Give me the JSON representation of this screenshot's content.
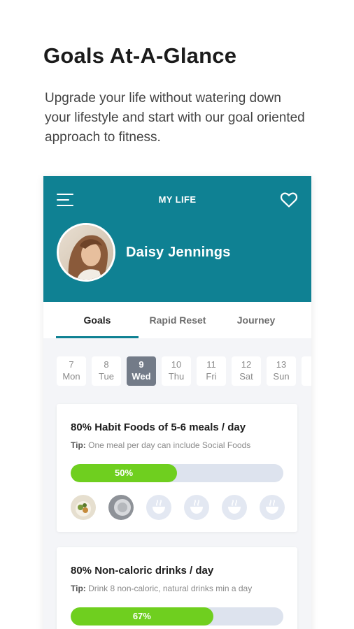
{
  "promo": {
    "headline": "Goals At-A-Glance",
    "subheadline": "Upgrade your life without watering down your lifestyle and start with our goal oriented approach to fitness."
  },
  "app": {
    "title": "MY LIFE",
    "brand_color": "#0f8193",
    "menu_icon": "hamburger-menu-icon",
    "favorite_icon": "heart-outline-icon"
  },
  "profile": {
    "name": "Daisy Jennings"
  },
  "tabs": [
    {
      "label": "Goals",
      "active": true
    },
    {
      "label": "Rapid Reset",
      "active": false
    },
    {
      "label": "Journey",
      "active": false
    }
  ],
  "days": [
    {
      "num": "7",
      "name": "Mon",
      "selected": false
    },
    {
      "num": "8",
      "name": "Tue",
      "selected": false
    },
    {
      "num": "9",
      "name": "Wed",
      "selected": true
    },
    {
      "num": "10",
      "name": "Thu",
      "selected": false
    },
    {
      "num": "11",
      "name": "Fri",
      "selected": false
    },
    {
      "num": "12",
      "name": "Sat",
      "selected": false
    },
    {
      "num": "13",
      "name": "Sun",
      "selected": false
    }
  ],
  "goals": [
    {
      "title": "80% Habit Foods of 5-6 meals / day",
      "tip_prefix": "Tip:",
      "tip": "One meal per day can include Social Foods",
      "progress_label": "50%",
      "progress_value": 0.5,
      "meals": [
        "photo",
        "photo",
        "empty",
        "empty",
        "empty",
        "empty"
      ]
    },
    {
      "title": "80% Non-caloric drinks / day",
      "tip_prefix": "Tip:",
      "tip": "Drink 8 non-caloric, natural drinks min a day",
      "progress_label": "67%",
      "progress_value": 0.67
    }
  ],
  "colors": {
    "progress_fill": "#6fcf1f",
    "progress_track": "#dde3ee",
    "selected_day": "#737b88"
  }
}
